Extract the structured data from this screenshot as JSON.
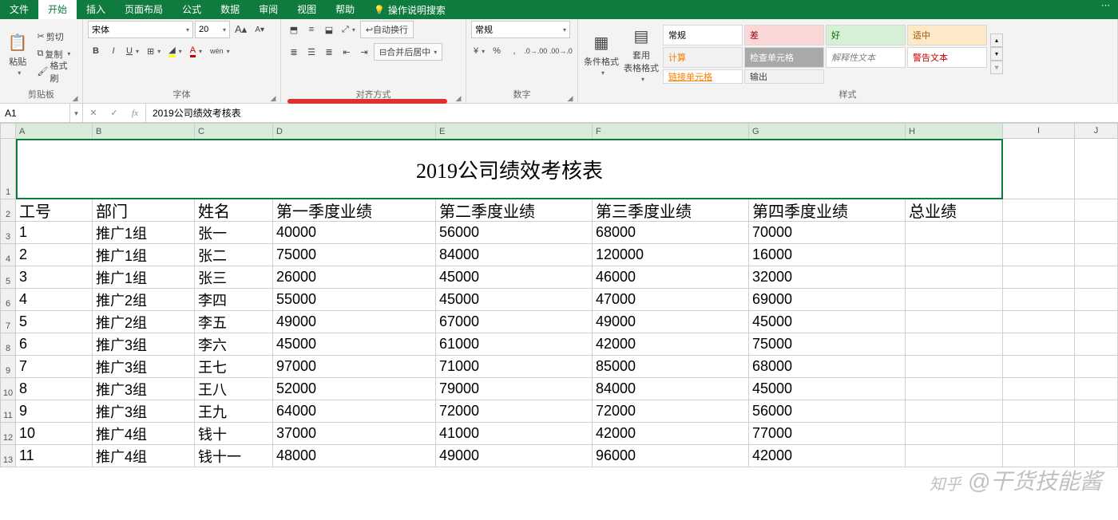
{
  "tabs": {
    "file": "文件",
    "home": "开始",
    "insert": "插入",
    "layout": "页面布局",
    "formulas": "公式",
    "data": "数据",
    "review": "审阅",
    "view": "视图",
    "help": "帮助",
    "tellme": "操作说明搜索"
  },
  "ribbon": {
    "clipboard": {
      "label": "剪贴板",
      "cut": "剪切",
      "copy": "复制",
      "painter": "格式刷",
      "paste": "粘贴"
    },
    "font": {
      "label": "字体",
      "name": "宋体",
      "size": "20"
    },
    "align": {
      "label": "对齐方式",
      "wrap": "自动换行",
      "merge": "合并后居中"
    },
    "number": {
      "label": "数字",
      "format": "常规"
    },
    "styles": {
      "label": "样式",
      "cond": "条件格式",
      "table": "套用\n表格格式",
      "gallery": [
        {
          "t": "常规",
          "bg": "#ffffff",
          "c": "#000"
        },
        {
          "t": "差",
          "bg": "#fcd7d7",
          "c": "#9c0006"
        },
        {
          "t": "好",
          "bg": "#d6f0d6",
          "c": "#006400"
        },
        {
          "t": "适中",
          "bg": "#fde8c8",
          "c": "#9c5700"
        },
        {
          "t": "计算",
          "bg": "#f2f2f2",
          "c": "#fa7d00"
        },
        {
          "t": "检查单元格",
          "bg": "#a9a9a9",
          "c": "#fff"
        },
        {
          "t": "解释性文本",
          "bg": "#ffffff",
          "c": "#7f7f7f"
        },
        {
          "t": "警告文本",
          "bg": "#ffffff",
          "c": "#c00"
        },
        {
          "t": "链接单元格",
          "bg": "#ffffff",
          "c": "#fa7d00"
        },
        {
          "t": "输出",
          "bg": "#f2f2f2",
          "c": "#3f3f3f"
        }
      ]
    }
  },
  "fbar": {
    "ref": "A1",
    "value": "2019公司绩效考核表"
  },
  "sheet": {
    "title": "2019公司绩效考核表",
    "cols": [
      "A",
      "B",
      "C",
      "D",
      "E",
      "F",
      "G",
      "H",
      "I",
      "J"
    ],
    "widths": [
      96,
      128,
      98,
      204,
      196,
      196,
      196,
      122,
      90,
      54
    ],
    "headers": [
      "工号",
      "部门",
      "姓名",
      "第一季度业绩",
      "第二季度业绩",
      "第三季度业绩",
      "第四季度业绩",
      "总业绩"
    ],
    "rows": [
      [
        "1",
        "推广1组",
        "张一",
        "40000",
        "56000",
        "68000",
        "70000",
        ""
      ],
      [
        "2",
        "推广1组",
        "张二",
        "75000",
        "84000",
        "120000",
        "16000",
        ""
      ],
      [
        "3",
        "推广1组",
        "张三",
        "26000",
        "45000",
        "46000",
        "32000",
        ""
      ],
      [
        "4",
        "推广2组",
        "李四",
        "55000",
        "45000",
        "47000",
        "69000",
        ""
      ],
      [
        "5",
        "推广2组",
        "李五",
        "49000",
        "67000",
        "49000",
        "45000",
        ""
      ],
      [
        "6",
        "推广3组",
        "李六",
        "45000",
        "61000",
        "42000",
        "75000",
        ""
      ],
      [
        "7",
        "推广3组",
        "王七",
        "97000",
        "71000",
        "85000",
        "68000",
        ""
      ],
      [
        "8",
        "推广3组",
        "王八",
        "52000",
        "79000",
        "84000",
        "45000",
        ""
      ],
      [
        "9",
        "推广3组",
        "王九",
        "64000",
        "72000",
        "72000",
        "56000",
        ""
      ],
      [
        "10",
        "推广4组",
        "钱十",
        "37000",
        "41000",
        "42000",
        "77000",
        ""
      ],
      [
        "11",
        "推广4组",
        "钱十一",
        "48000",
        "49000",
        "96000",
        "42000",
        ""
      ]
    ]
  },
  "watermark": {
    "site": "知乎",
    "author": "@干货技能酱"
  },
  "chart_data": {
    "type": "table",
    "title": "2019公司绩效考核表",
    "columns": [
      "工号",
      "部门",
      "姓名",
      "第一季度业绩",
      "第二季度业绩",
      "第三季度业绩",
      "第四季度业绩",
      "总业绩"
    ],
    "rows": [
      [
        1,
        "推广1组",
        "张一",
        40000,
        56000,
        68000,
        70000,
        null
      ],
      [
        2,
        "推广1组",
        "张二",
        75000,
        84000,
        120000,
        16000,
        null
      ],
      [
        3,
        "推广1组",
        "张三",
        26000,
        45000,
        46000,
        32000,
        null
      ],
      [
        4,
        "推广2组",
        "李四",
        55000,
        45000,
        47000,
        69000,
        null
      ],
      [
        5,
        "推广2组",
        "李五",
        49000,
        67000,
        49000,
        45000,
        null
      ],
      [
        6,
        "推广3组",
        "李六",
        45000,
        61000,
        42000,
        75000,
        null
      ],
      [
        7,
        "推广3组",
        "王七",
        97000,
        71000,
        85000,
        68000,
        null
      ],
      [
        8,
        "推广3组",
        "王八",
        52000,
        79000,
        84000,
        45000,
        null
      ],
      [
        9,
        "推广3组",
        "王九",
        64000,
        72000,
        72000,
        56000,
        null
      ],
      [
        10,
        "推广4组",
        "钱十",
        37000,
        41000,
        42000,
        77000,
        null
      ],
      [
        11,
        "推广4组",
        "钱十一",
        48000,
        49000,
        96000,
        42000,
        null
      ]
    ]
  }
}
